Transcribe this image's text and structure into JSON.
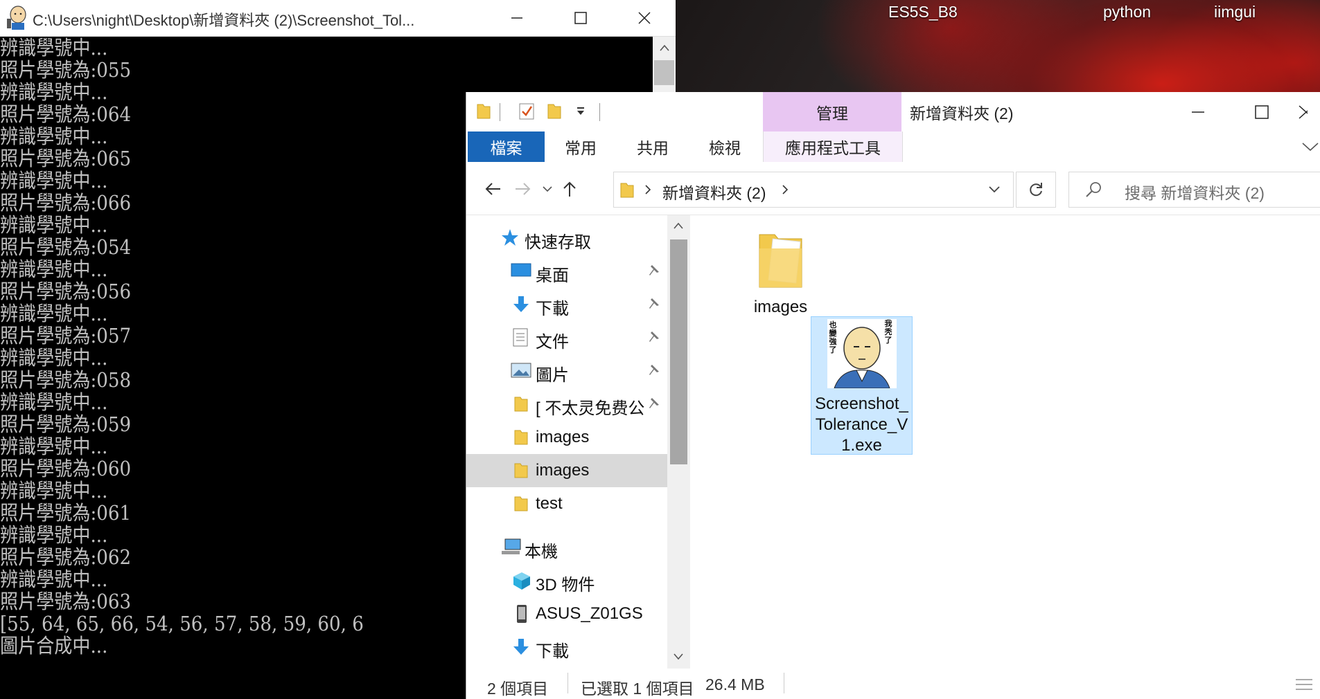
{
  "desktop": {
    "labels": [
      "ES5S_B8",
      "python",
      "iimgui"
    ]
  },
  "console": {
    "title": "C:\\Users\\night\\Desktop\\新增資料夾 (2)\\Screenshot_Tol...",
    "lines": [
      "辨識學號中...",
      "照片學號為:055",
      "辨識學號中...",
      "照片學號為:064",
      "辨識學號中...",
      "照片學號為:065",
      "辨識學號中...",
      "照片學號為:066",
      "辨識學號中...",
      "照片學號為:054",
      "辨識學號中...",
      "照片學號為:056",
      "辨識學號中...",
      "照片學號為:057",
      "辨識學號中...",
      "照片學號為:058",
      "辨識學號中...",
      "照片學號為:059",
      "辨識學號中...",
      "照片學號為:060",
      "辨識學號中...",
      "照片學號為:061",
      "辨識學號中...",
      "照片學號為:062",
      "辨識學號中...",
      "照片學號為:063",
      "[55, 64, 65, 66, 54, 56, 57, 58, 59, 60, 6",
      "圖片合成中..."
    ]
  },
  "explorer": {
    "title": "新增資料夾 (2)",
    "manage_tab": "管理",
    "ribbon_tabs": {
      "file": "檔案",
      "home": "常用",
      "share": "共用",
      "view": "檢視",
      "app_tools": "應用程式工具"
    },
    "address": "新增資料夾 (2)",
    "search_placeholder": "搜尋 新增資料夾 (2)",
    "nav": {
      "quick_access": "快速存取",
      "desktop": "桌面",
      "downloads": "下載",
      "documents": "文件",
      "pictures": "圖片",
      "bt_folder": "[ 不太灵免费公",
      "images1": "images",
      "images2": "images",
      "test": "test",
      "this_pc": "本機",
      "objects3d": "3D 物件",
      "asus": "ASUS_Z01GS",
      "downloads2": "下載"
    },
    "files": [
      {
        "name": "images",
        "type": "folder"
      },
      {
        "name": "Screenshot_Tolerance_V1.exe",
        "type": "exe"
      }
    ],
    "exe_icon_text": {
      "right": "我秃了",
      "left": "也變強了"
    },
    "status": {
      "count": "2 個項目",
      "selected": "已選取 1 個項目",
      "size": "26.4 MB"
    }
  }
}
